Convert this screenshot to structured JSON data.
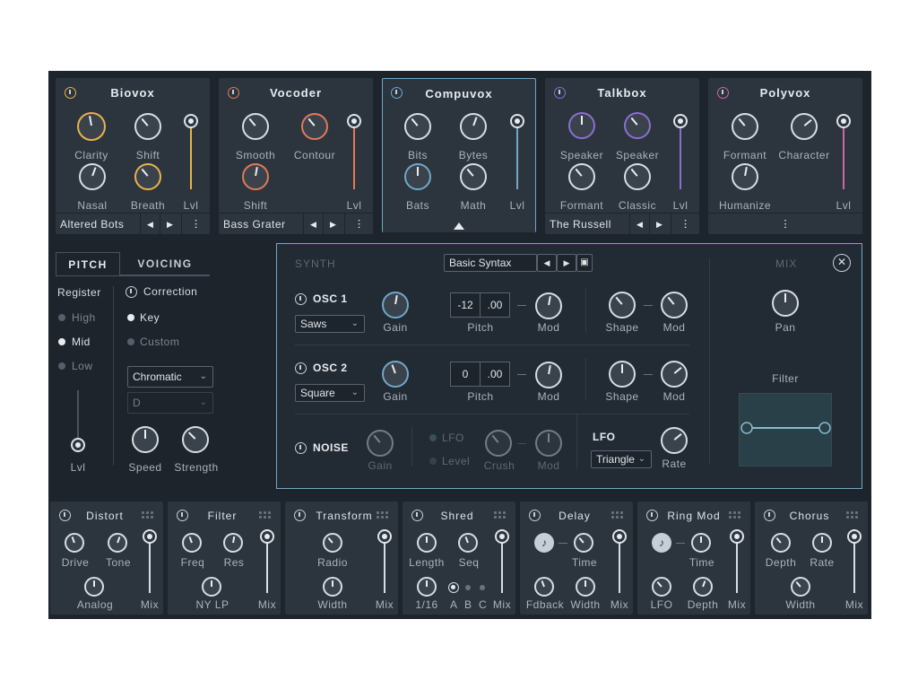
{
  "voices": [
    {
      "name": "Biovox",
      "color": "#e8b34a",
      "knobs": [
        "Clarity",
        "Shift",
        "Nasal",
        "Breath"
      ],
      "lvl": "Lvl",
      "preset": "Altered Bots"
    },
    {
      "name": "Vocoder",
      "color": "#e2795a",
      "knobs": [
        "Smooth",
        "Contour",
        "Shift"
      ],
      "lvl": "Lvl",
      "preset": "Bass Grater"
    },
    {
      "name": "Compuvox",
      "color": "#6fa8c9",
      "knobs": [
        "Bits",
        "Bytes",
        "Bats",
        "Math"
      ],
      "lvl": "Lvl"
    },
    {
      "name": "Talkbox",
      "color": "#8a6fd1",
      "knobs": [
        "Speaker",
        "Speaker",
        "Formant",
        "Classic"
      ],
      "lvl": "Lvl",
      "preset": "The Russell"
    },
    {
      "name": "Polyvox",
      "color": "#c96aa6",
      "knobs": [
        "Formant",
        "Character",
        "Humanize"
      ],
      "lvl": "Lvl"
    }
  ],
  "pitch": {
    "tab_pitch": "PITCH",
    "tab_voicing": "VOICING",
    "register": "Register",
    "high": "High",
    "mid": "Mid",
    "low": "Low",
    "lvl": "Lvl",
    "correction": "Correction",
    "key": "Key",
    "custom": "Custom",
    "scale": "Chromatic",
    "key_value": "D",
    "speed": "Speed",
    "strength": "Strength"
  },
  "synth": {
    "label": "SYNTH",
    "preset": "Basic Syntax",
    "mix": "MIX",
    "pan": "Pan",
    "filter": "Filter",
    "osc1": {
      "label": "OSC 1",
      "wave": "Saws",
      "gain": "Gain",
      "pitch_a": "-12",
      "pitch_b": ".00",
      "pitch": "Pitch",
      "mod": "Mod",
      "shape": "Shape",
      "mod2": "Mod"
    },
    "osc2": {
      "label": "OSC 2",
      "wave": "Square",
      "gain": "Gain",
      "pitch_a": "0",
      "pitch_b": ".00",
      "pitch": "Pitch",
      "mod": "Mod",
      "shape": "Shape",
      "mod2": "Mod"
    },
    "noise": {
      "label": "NOISE",
      "gain": "Gain",
      "lfo": "LFO",
      "level": "Level",
      "crush": "Crush",
      "mod": "Mod"
    },
    "lfo": {
      "label": "LFO",
      "wave": "Triangle",
      "rate": "Rate"
    }
  },
  "effects": [
    {
      "name": "Distort",
      "labels": [
        "Drive",
        "Tone",
        "Analog"
      ],
      "mix": "Mix"
    },
    {
      "name": "Filter",
      "labels": [
        "Freq",
        "Res",
        "NY LP"
      ],
      "mix": "Mix"
    },
    {
      "name": "Transform",
      "labels": [
        "Radio",
        "Width"
      ],
      "mix": "Mix"
    },
    {
      "name": "Shred",
      "labels": [
        "Length",
        "Seq",
        "1/16",
        "A",
        "B",
        "C"
      ],
      "mix": "Mix"
    },
    {
      "name": "Delay",
      "labels": [
        "Time",
        "Fdback",
        "Width"
      ],
      "mix": "Mix"
    },
    {
      "name": "Ring Mod",
      "labels": [
        "Time",
        "LFO",
        "Depth"
      ],
      "mix": "Mix"
    },
    {
      "name": "Chorus",
      "labels": [
        "Depth",
        "Rate",
        "Width"
      ],
      "mix": "Mix"
    }
  ]
}
